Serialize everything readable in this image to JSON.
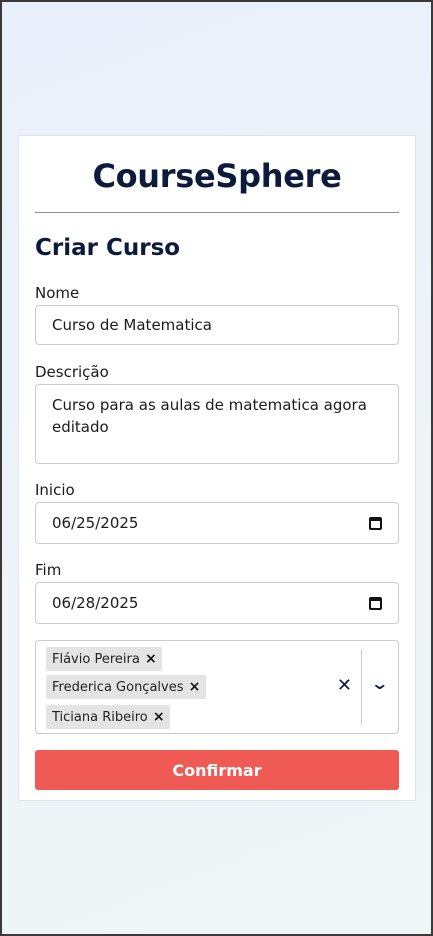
{
  "app": {
    "title": "CourseSphere"
  },
  "form": {
    "heading": "Criar Curso",
    "name": {
      "label": "Nome",
      "value": "Curso de Matematica"
    },
    "description": {
      "label": "Descrição",
      "value": "Curso para as aulas de matematica agora editado"
    },
    "start": {
      "label": "Inicio",
      "value": "06/25/2025"
    },
    "end": {
      "label": "Fim",
      "value": "06/28/2025"
    },
    "instructors": {
      "selected": [
        {
          "label": "Flávio Pereira"
        },
        {
          "label": "Frederica Gonçalves"
        },
        {
          "label": "Ticiana Ribeiro"
        }
      ],
      "remove_glyph": "×",
      "clear_glyph": "✕",
      "dropdown_glyph": "⌄"
    },
    "submit_label": "Confirmar"
  },
  "colors": {
    "brand_text": "#0c1a3b",
    "button_bg": "#f05a55"
  }
}
